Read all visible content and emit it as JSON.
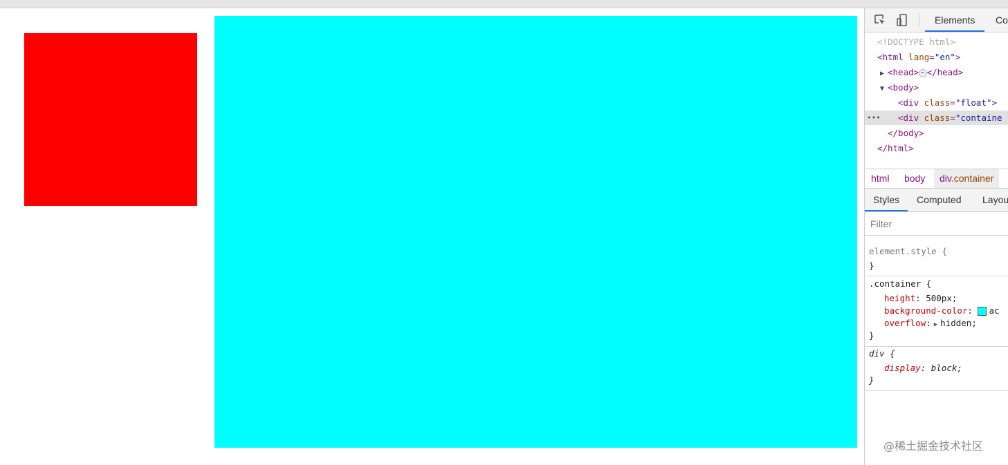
{
  "page": {
    "float_color": "#ff0000",
    "container_color": "#00ffff"
  },
  "devtools": {
    "tabs": [
      "Elements",
      "Co"
    ],
    "dom": {
      "doctype": "<!DOCTYPE html>",
      "html_open_tag": "<html",
      "html_attr": "lang",
      "html_attr_val": "\"en\"",
      "head_open": "<head>",
      "head_ellipsis": "⋯",
      "head_close": "</head>",
      "body_open": "<body>",
      "div1_tag": "<div",
      "div1_attr": "class",
      "div1_val": "\"float\">",
      "div2_tag": "<div",
      "div2_attr": "class",
      "div2_val": "\"containe",
      "body_close": "</body>",
      "html_close": "</html>",
      "row_dots": "•••"
    },
    "breadcrumbs": {
      "html": "html",
      "body": "body",
      "current_tag": "div",
      "current_class": ".container"
    },
    "subtabs": [
      "Styles",
      "Computed",
      "Layou"
    ],
    "filter_placeholder": "Filter",
    "styles": {
      "element_style_selector": "element.style {",
      "close_brace": "}",
      "container_selector": ".container {",
      "height_prop": "height",
      "height_val": "500px;",
      "bg_prop": "background-color",
      "bg_val": "ac",
      "overflow_prop": "overflow",
      "overflow_val": "hidden;",
      "div_selector": "div {",
      "display_prop": "display",
      "display_val": "block;"
    },
    "watermark": "@稀土掘金技术社区"
  }
}
